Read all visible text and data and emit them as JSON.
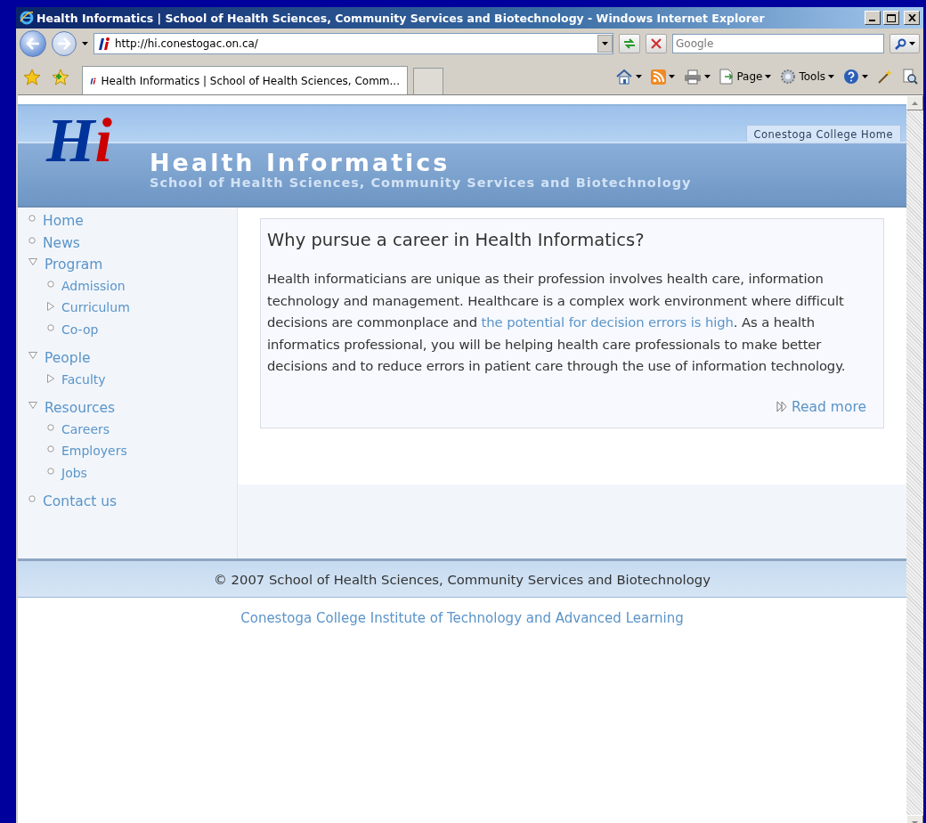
{
  "window": {
    "title": "Health Informatics | School of Health Sciences, Community Services and Biotechnology - Windows Internet Explorer"
  },
  "address_bar": {
    "url": "http://hi.conestogac.on.ca/"
  },
  "search": {
    "placeholder": "Google"
  },
  "tabs": [
    {
      "label": "Health Informatics | School of Health Sciences, Comm...",
      "selected": true
    }
  ],
  "command_bar": [
    {
      "kind": "icon"
    },
    {
      "kind": "icon"
    },
    {
      "kind": "icon"
    },
    {
      "kind": "menu",
      "label": "Page"
    },
    {
      "kind": "menu",
      "label": "Tools"
    },
    {
      "kind": "icon"
    },
    {
      "kind": "plain"
    },
    {
      "kind": "plain"
    }
  ],
  "header": {
    "logo": {
      "first": "H",
      "second": "i"
    },
    "title": "Health Informatics",
    "subtitle": "School of Health Sciences, Community Services and Biotechnology",
    "home_link": "Conestoga College Home"
  },
  "sidebar": {
    "items": [
      {
        "label": "Home",
        "kind": "leaf"
      },
      {
        "label": "News",
        "kind": "leaf"
      },
      {
        "label": "Program",
        "kind": "folder",
        "expanded": true,
        "children": [
          {
            "label": "Admission",
            "kind": "leaf"
          },
          {
            "label": "Curriculum",
            "kind": "folder",
            "expanded": false
          },
          {
            "label": "Co-op",
            "kind": "leaf"
          }
        ]
      },
      {
        "label": "People",
        "kind": "folder",
        "expanded": true,
        "children": [
          {
            "label": "Faculty",
            "kind": "folder",
            "expanded": false
          }
        ]
      },
      {
        "label": "Resources",
        "kind": "folder",
        "expanded": true,
        "children": [
          {
            "label": "Careers",
            "kind": "leaf"
          },
          {
            "label": "Employers",
            "kind": "leaf"
          },
          {
            "label": "Jobs",
            "kind": "leaf"
          }
        ]
      },
      {
        "label": "Contact us",
        "kind": "leaf"
      }
    ]
  },
  "article": {
    "heading": "Why pursue a career in Health Informatics?",
    "text_before": "Health informaticians are unique as their profession involves health care, information technology and management. Healthcare is a complex work environment where difficult decisions are commonplace and",
    "link": "the potential for decision errors is high",
    "text_after": ". As a health informatics professional, you will be helping health care professionals to make better decisions and to reduce errors in patient care through the use of information technology.",
    "read_more": "Read more"
  },
  "footer": {
    "copyright": "© 2007 School of Health Sciences, Community Services and Biotechnology",
    "link": "Conestoga College Institute of Technology and Advanced Learning"
  }
}
